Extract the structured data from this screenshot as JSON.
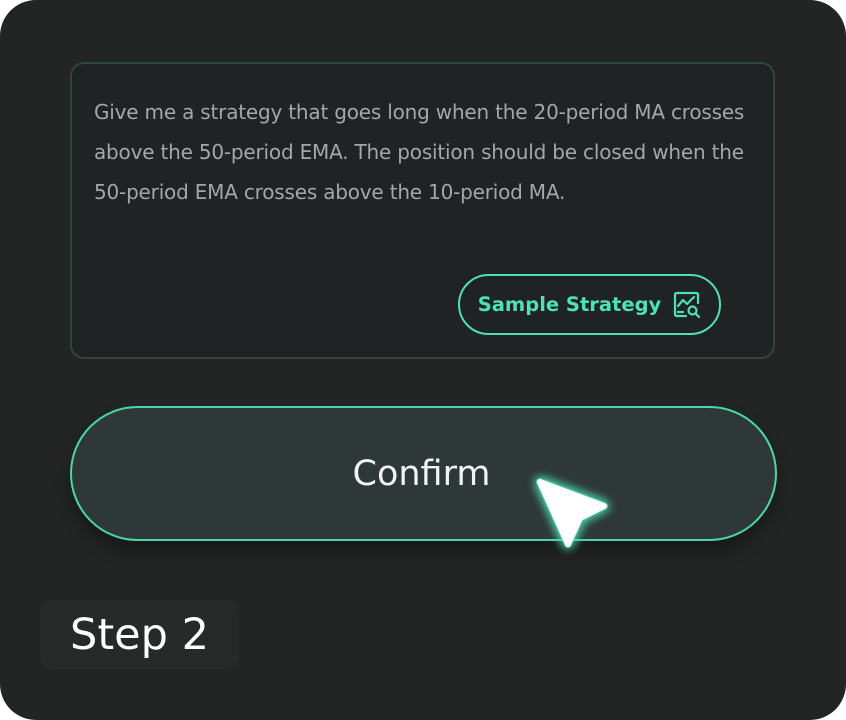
{
  "prompt": {
    "text": "Give me a strategy that goes long when the 20-period MA crosses above the 50-period EMA. The position should be closed when the 50-period EMA crosses above the 10-period MA.",
    "sample_button": {
      "label": "Sample Strategy",
      "icon": "chart-search-icon"
    }
  },
  "confirm_button": {
    "label": "Confirm"
  },
  "cursor": {
    "icon": "pointer-cursor-icon"
  },
  "step_badge": {
    "label": "Step 2"
  },
  "colors": {
    "background": "#232525",
    "accent": "#4fe0b6",
    "prompt_text": "#a3a8a7",
    "button_fill": "#2f3838",
    "text_light": "#f2f4f3"
  }
}
